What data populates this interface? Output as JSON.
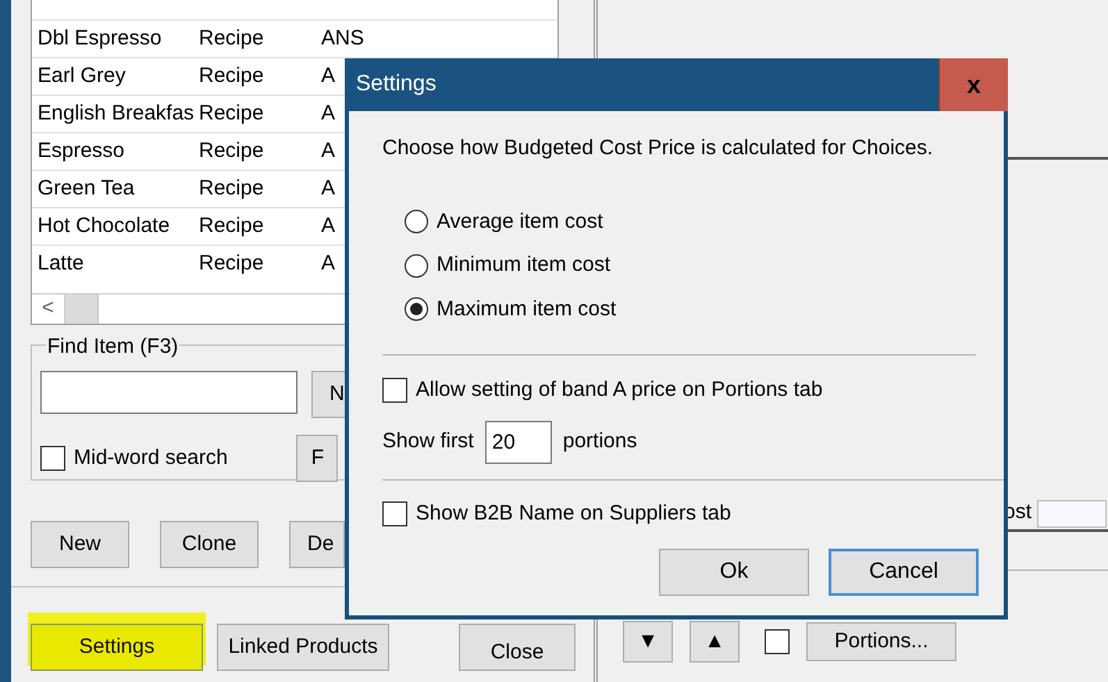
{
  "list": {
    "rows": [
      {
        "name": "Dbl Espresso",
        "type": "Recipe",
        "column_3": "ANS"
      },
      {
        "name": "Earl Grey",
        "type": "Recipe",
        "column_3": "A"
      },
      {
        "name": "English Breakfas",
        "type": "Recipe",
        "column_3": "A"
      },
      {
        "name": "Espresso",
        "type": "Recipe",
        "column_3": "A"
      },
      {
        "name": "Green Tea",
        "type": "Recipe",
        "column_3": "A"
      },
      {
        "name": "Hot Chocolate",
        "type": "Recipe",
        "column_3": "A"
      },
      {
        "name": "Latte",
        "type": "Recipe",
        "column_3": "A"
      }
    ],
    "scroll_left": "<"
  },
  "find_item": {
    "label": "Find Item (F3)",
    "side_buttons": [
      "N",
      "F"
    ],
    "mid_word_search": {
      "label": "Mid-word search",
      "checked": false
    }
  },
  "action_buttons": [
    "New",
    "Clone",
    "De"
  ],
  "bottom_buttons": [
    {
      "label": "Settings",
      "highlighted": true
    },
    {
      "label": "Linked Products",
      "highlighted": false
    },
    {
      "label": "Close",
      "highlighted": false
    }
  ],
  "right_panel": {
    "cost_label": "ost",
    "down_button": "▼",
    "up_button": "▲",
    "portions_checkbox": {
      "checked": false
    },
    "portions_button": "Portions..."
  },
  "dialog": {
    "title": "Settings",
    "close": "x",
    "intro": "Choose how Budgeted Cost Price is calculated for Choices.",
    "options": [
      {
        "label": "Average item cost",
        "selected": false
      },
      {
        "label": "Minimum item cost",
        "selected": false
      },
      {
        "label": "Maximum item cost",
        "selected": true
      }
    ],
    "allow_band_a": {
      "label": "Allow setting of band A price on Portions tab",
      "checked": false
    },
    "show_first": {
      "label": "Show first",
      "value": "20",
      "suffix": "portions"
    },
    "show_b2b": {
      "label": "Show B2B Name on Suppliers tab",
      "checked": false
    },
    "buttons": [
      {
        "label": "Ok",
        "focused": false
      },
      {
        "label": "Cancel",
        "focused": true
      }
    ]
  }
}
